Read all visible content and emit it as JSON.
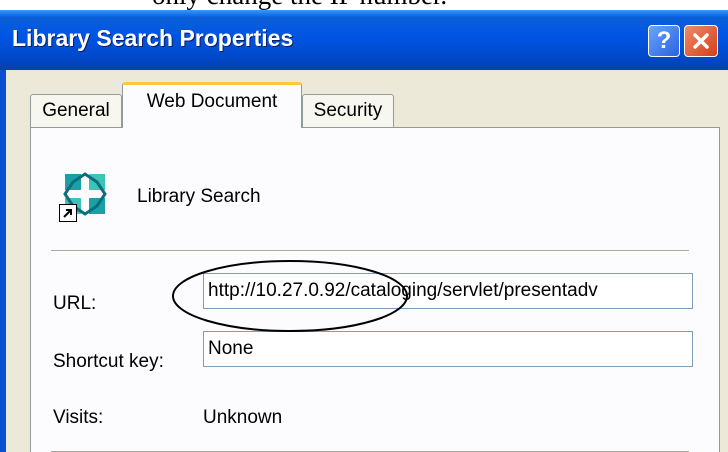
{
  "document": {
    "caption": "only change the IP number."
  },
  "window": {
    "title": "Library Search Properties",
    "help_label": "?",
    "icons": {
      "help": "help-icon",
      "close": "close-icon"
    },
    "colors": {
      "titlebar": "#0054e3",
      "close": "#d2401a",
      "tab_highlight": "#ffc83c",
      "face": "#ece9d8"
    }
  },
  "tabs": [
    {
      "label": "General"
    },
    {
      "label": "Web Document",
      "selected": true
    },
    {
      "label": "Security"
    }
  ],
  "panel": {
    "item_name": "Library Search",
    "item_icon": "web-shortcut-icon",
    "url_label": "URL:",
    "url_value": "http://10.27.0.92/cataloging/servlet/presentadv",
    "shortcut_label": "Shortcut key:",
    "shortcut_value": "None",
    "visits_label": "Visits:",
    "visits_value": "Unknown"
  }
}
